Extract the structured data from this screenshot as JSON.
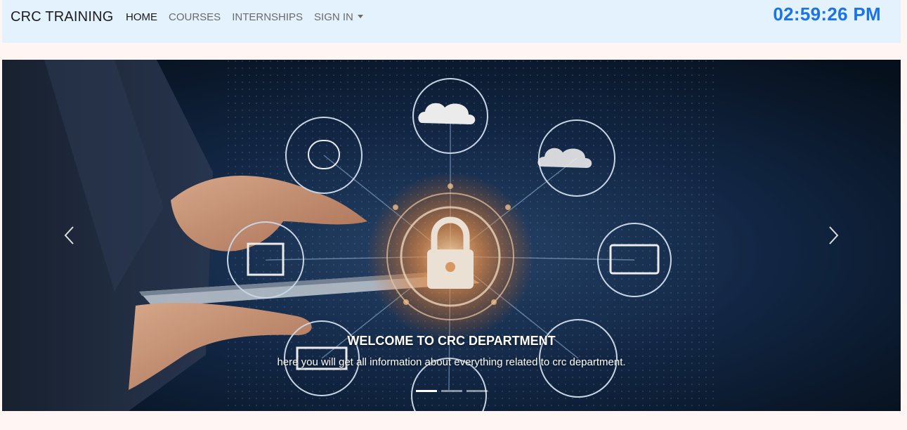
{
  "navbar": {
    "brand": "CRC TRAINING",
    "links": [
      {
        "label": "HOME",
        "active": true
      },
      {
        "label": "COURSES",
        "active": false
      },
      {
        "label": "INTERNSHIPS",
        "active": false
      }
    ],
    "dropdown_label": "SIGN IN",
    "clock": "02:59:26 PM",
    "background": "#e3f2fd",
    "clock_color": "#1a73e8"
  },
  "carousel": {
    "caption_title": "WELCOME TO CRC DEPARTMENT",
    "caption_text": "here you will get all information about everything related to crc department.",
    "prev_icon": "chevron-left-icon",
    "next_icon": "chevron-right-icon",
    "indicator_count": 3,
    "active_indicator": 1
  },
  "page": {
    "background": "#fff5f3"
  }
}
